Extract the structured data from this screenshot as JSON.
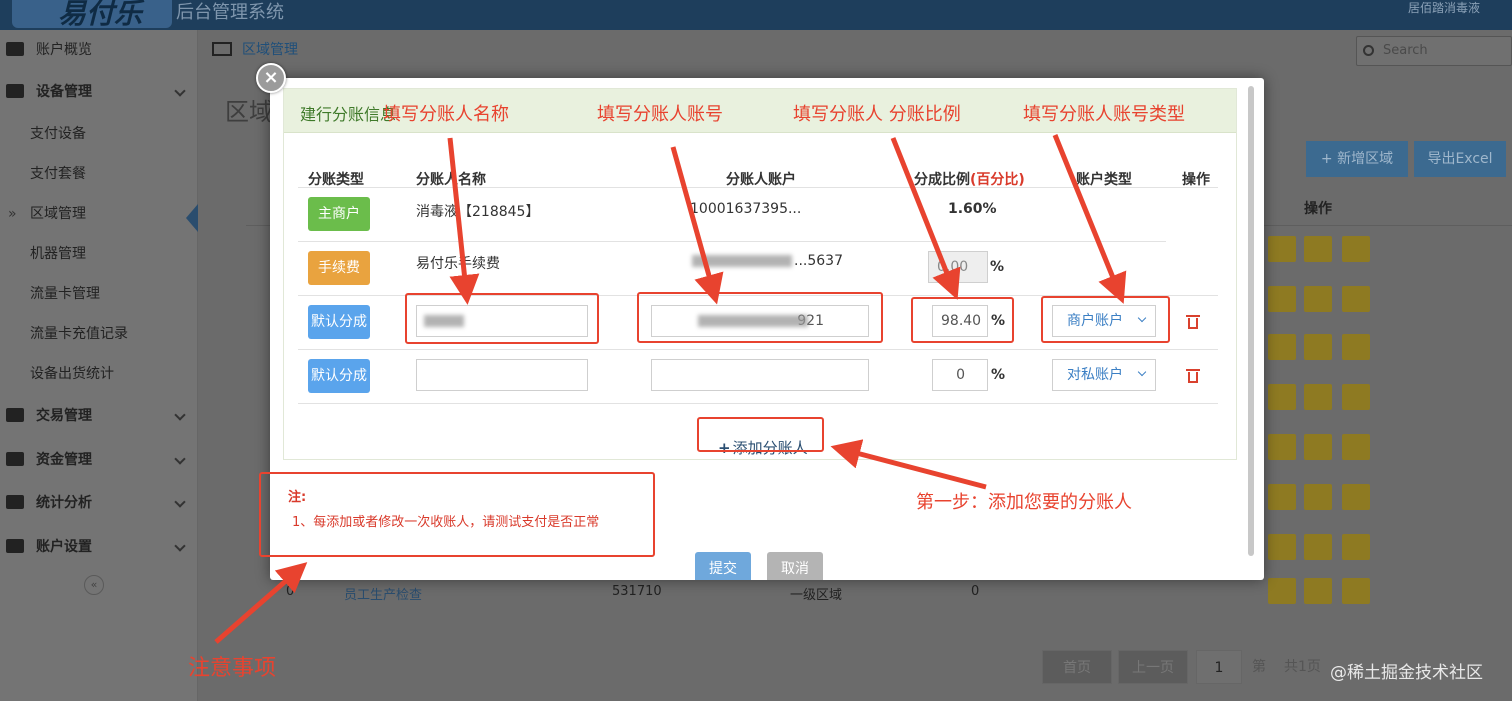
{
  "topbar": {
    "logo_text": "易付乐",
    "system_title": "后台管理系统",
    "user": "居佰踏消毒液"
  },
  "sidebar": {
    "items": [
      {
        "label": "账户概览",
        "icon": "monitor-icon"
      },
      {
        "label": "设备管理",
        "icon": "sitemap-icon"
      },
      {
        "label": "交易管理",
        "icon": "book-icon"
      },
      {
        "label": "资金管理",
        "icon": "credit-card-icon"
      },
      {
        "label": "统计分析",
        "icon": "server-icon"
      },
      {
        "label": "账户设置",
        "icon": "user-icon"
      }
    ],
    "sub_items": [
      "支付设备",
      "支付套餐",
      "区域管理",
      "机器管理",
      "流量卡管理",
      "流量卡充值记录",
      "设备出货统计"
    ],
    "active_mark": "»",
    "collapse": "«"
  },
  "breadcrumb": "区域管理",
  "search": {
    "placeholder": "Search"
  },
  "background_page": {
    "title": "区域",
    "add_button": "+ 新增区域",
    "export_button": "导出Excel",
    "header_op": "操作",
    "row": {
      "idx": "0",
      "name": "员工生产检查",
      "code": "531710",
      "level": "一级区域",
      "count": "0"
    },
    "pager": {
      "first": "首页",
      "prev": "上一页",
      "page": "1",
      "page_label": "第",
      "total": "共1页"
    }
  },
  "modal": {
    "close_icon": "×",
    "panel_title": "建行分账信息",
    "headers": {
      "type": "分账类型",
      "name": "分账人名称",
      "account": "分账人账户",
      "ratio": "分成比例",
      "ratio_unit": "(百分比)",
      "acct_type": "账户类型",
      "op": "操作"
    },
    "rows": [
      {
        "type": "主商户",
        "name": "消毒液【218845】",
        "account": "10001637395...",
        "ratio": "1.60%"
      },
      {
        "type": "手续费",
        "name": "易付乐手续费",
        "account": "...5637",
        "ratio": "0.00"
      },
      {
        "type": "默认分成",
        "name": "",
        "account": "921",
        "ratio": "98.40",
        "acct_type": "商户账户"
      },
      {
        "type": "默认分成",
        "name": "",
        "account": "",
        "ratio": "0",
        "acct_type": "对私账户"
      }
    ],
    "percent": "%",
    "add_link": "添加分账人",
    "note_title": "注:",
    "note_text": "1、每添加或者修改一次收账人，请测试支付是否正常",
    "submit": "提交",
    "cancel": "取消"
  },
  "annotations": {
    "name": "填写分账人名称",
    "account": "填写分账人账号",
    "ratio": "填写分账人 分账比例",
    "acct_type": "填写分账人账号类型",
    "step1": "第一步：添加您要的分账人",
    "notice": "注意事项"
  },
  "colors": {
    "annotation_red": "#e8432f",
    "green_badge": "#6bbd4b",
    "orange_badge": "#e9a33f",
    "blue_badge": "#5aa4ec"
  },
  "watermark": "@稀土掘金技术社区"
}
